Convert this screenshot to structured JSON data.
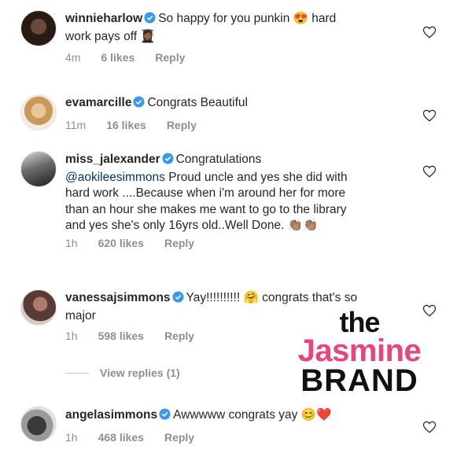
{
  "comments": [
    {
      "username": "winnieharlow",
      "verified": true,
      "lines": [
        "So happy for you punkin 😍 hard",
        "work pays off 👩🏾‍🎓"
      ],
      "time": "4m",
      "likes": "6 likes",
      "reply": "Reply"
    },
    {
      "username": "evamarcille",
      "verified": true,
      "lines": [
        "Congrats Beautiful"
      ],
      "time": "11m",
      "likes": "16 likes",
      "reply": "Reply"
    },
    {
      "username": "miss_jalexander",
      "verified": true,
      "mention": "@aokileesimmons",
      "lines": [
        "Congratulations",
        "Proud uncle and yes she did with",
        "hard work ....Because when i'm around her for more",
        "than an hour she makes me want to go to the library",
        "and yes she's only 16yrs old..Well Done. 👏🏽👏🏽"
      ],
      "time": "1h",
      "likes": "620 likes",
      "reply": "Reply"
    },
    {
      "username": "vanessajsimmons",
      "verified": true,
      "lines": [
        "Yay!!!!!!!!!! 🤗 congrats that's so",
        "major"
      ],
      "time": "1h",
      "likes": "598 likes",
      "reply": "Reply",
      "view_replies": "View replies (1)"
    },
    {
      "username": "angelasimmons",
      "verified": true,
      "lines": [
        "Awwwww congrats yay 😊❤️"
      ],
      "time": "1h",
      "likes": "468 likes",
      "reply": "Reply"
    }
  ],
  "watermark": {
    "line1": "the",
    "line2": "Jasmine",
    "line3": "BRAND"
  },
  "icons": {
    "like": "heart-outline-icon",
    "verified": "verified-badge-icon"
  },
  "colors": {
    "verified": "#3897f0",
    "meta": "#8e8e8e",
    "mention": "#003569",
    "watermark_accent": "#e8457d"
  }
}
